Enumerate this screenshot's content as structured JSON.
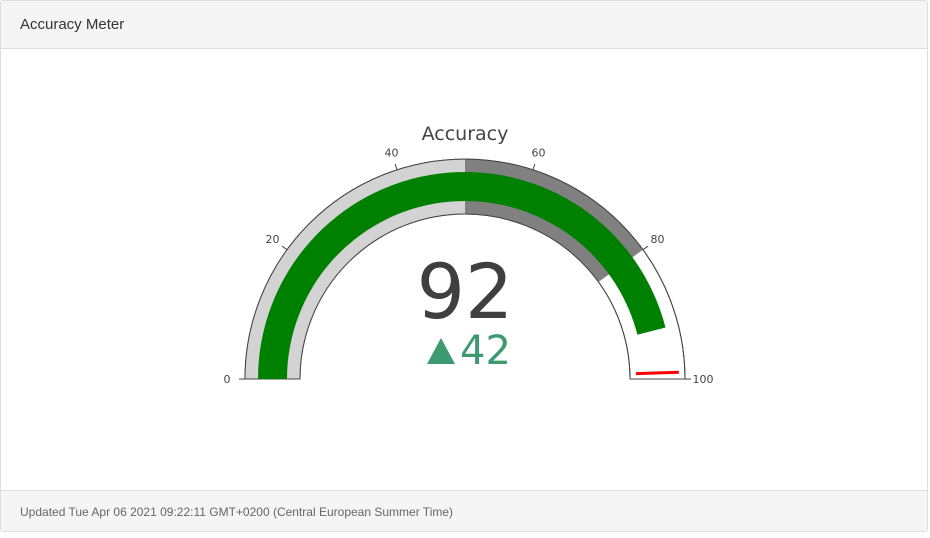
{
  "header": {
    "title": "Accuracy Meter"
  },
  "footer": {
    "updated_text": "Updated Tue Apr 06 2021 09:22:11 GMT+0200 (Central European Summer Time)"
  },
  "chart_data": {
    "type": "gauge",
    "title": "Accuracy",
    "value": 92,
    "value_text": "92",
    "delta": 42,
    "delta_text": "42",
    "delta_direction": "increasing",
    "axis_range": [
      0,
      100
    ],
    "ticks": [
      0,
      20,
      40,
      60,
      80,
      100
    ],
    "tick_labels": [
      "0",
      "20",
      "40",
      "60",
      "80",
      "100"
    ],
    "steps": [
      {
        "range": [
          0,
          50
        ],
        "color": "#d3d3d3"
      },
      {
        "range": [
          50,
          80
        ],
        "color": "#808080"
      }
    ],
    "bar": {
      "value": 92,
      "color": "#008000"
    },
    "threshold": {
      "value": 99,
      "color": "#ff0000"
    },
    "colors": {
      "delta_increasing": "#3d9970",
      "number": "#3f3f3f"
    }
  }
}
